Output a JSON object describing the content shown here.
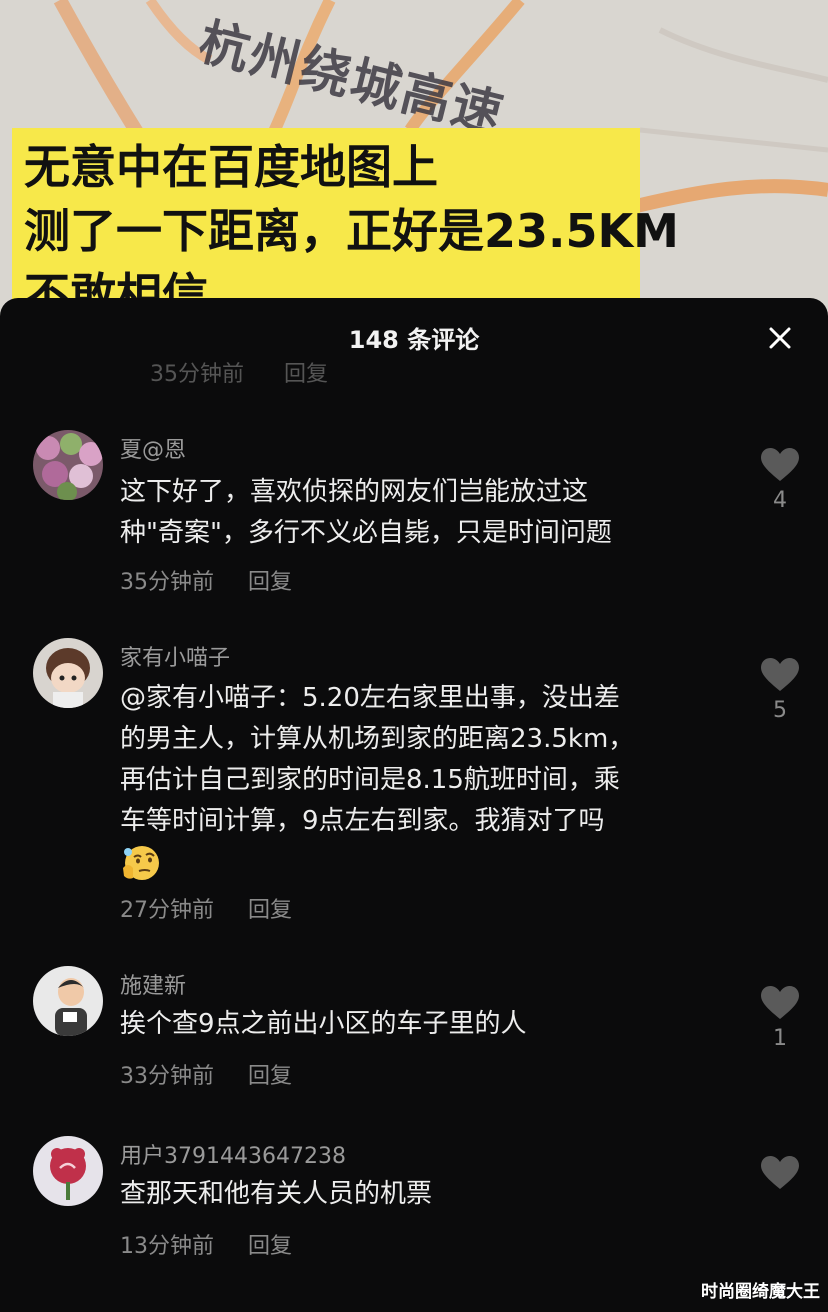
{
  "video": {
    "map_label": "杭州绕城高速",
    "caption_lines": [
      "无意中在百度地图上",
      "测了一下距离，正好是23.5KM",
      "不敢相信"
    ]
  },
  "sheet": {
    "title": "148 条评论",
    "close_icon": "close-icon"
  },
  "comments": [
    {
      "user": "夏@恩",
      "lines": [
        "这下好了，喜欢侦探的网友们岂能放过这",
        "种\"奇案\"，多行不义必自毙，只是时间问题"
      ],
      "time": "35分钟前",
      "reply": "回复",
      "likes": "4"
    },
    {
      "user": "家有小喵子",
      "lines": [
        "@家有小喵子：5.20左右家里出事，没出差",
        "的男主人，计算从机场到家的距离23.5km，",
        "再估计自己到家的时间是8.15航班时间，乘",
        "车等时间计算，9点左右到家。我猜对了吗"
      ],
      "emoji": "thinking-face-emoji",
      "time": "27分钟前",
      "reply": "回复",
      "likes": "5"
    },
    {
      "user": "施建新",
      "lines": [
        "挨个查9点之前出小区的车子里的人"
      ],
      "time": "33分钟前",
      "reply": "回复",
      "likes": "1"
    },
    {
      "user": "用户3791443647238",
      "lines": [
        "查那天和他有关人员的机票"
      ],
      "time": "13分钟前",
      "reply": "回复",
      "likes": ""
    }
  ],
  "watermark": "时尚圈绮魔大王",
  "colors": {
    "sheet_bg": "#0b0b0c",
    "caption_bg": "#f7e84a",
    "text_primary": "#ededed",
    "text_secondary": "#8a8a8a",
    "like_icon": "#5a5a5a"
  }
}
